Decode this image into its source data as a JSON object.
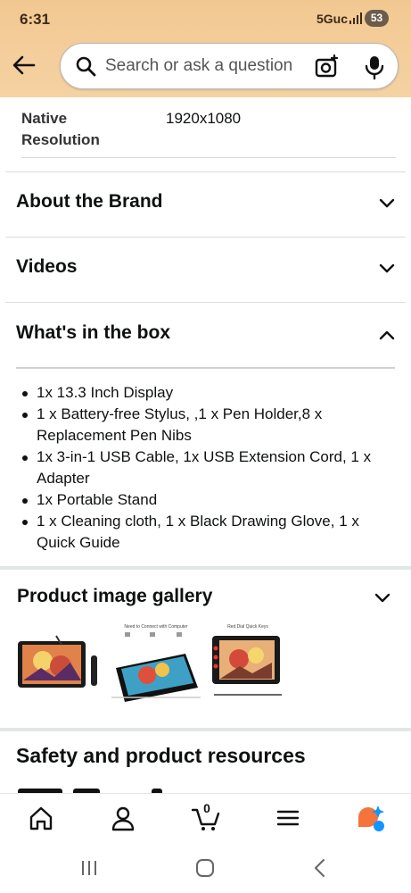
{
  "status_bar": {
    "time": "6:31",
    "network": "5Guc",
    "battery": "53"
  },
  "search": {
    "placeholder": "Search or ask a question"
  },
  "spec_row": {
    "label": "Native Resolution",
    "value": "1920x1080"
  },
  "sections": [
    {
      "title": "About the Brand",
      "expanded": false
    },
    {
      "title": "Videos",
      "expanded": false
    },
    {
      "title": "What's in the box",
      "expanded": true
    }
  ],
  "box_items": [
    "1x 13.3 Inch Display",
    "1 x Battery-free Stylus, ,1 x Pen Holder,8 x Replacement Pen Nibs",
    "1x 3-in-1 USB Cable, 1x USB Extension Cord, 1 x Adapter",
    "1x Portable Stand",
    "1 x Cleaning cloth, 1 x Black Drawing Glove, 1 x Quick Guide"
  ],
  "gallery": {
    "title": "Product image gallery",
    "thumb_captions": [
      "Need to Connect with Computer",
      "Red Dial Quick Keys"
    ]
  },
  "safety_title": "Safety and product resources",
  "bottom_nav": {
    "cart_count": "0"
  },
  "colors": {
    "header_bg": "#f3cc98",
    "divider": "#d5d9d9",
    "accent_orange": "#f4743b",
    "accent_blue": "#1196ff"
  }
}
